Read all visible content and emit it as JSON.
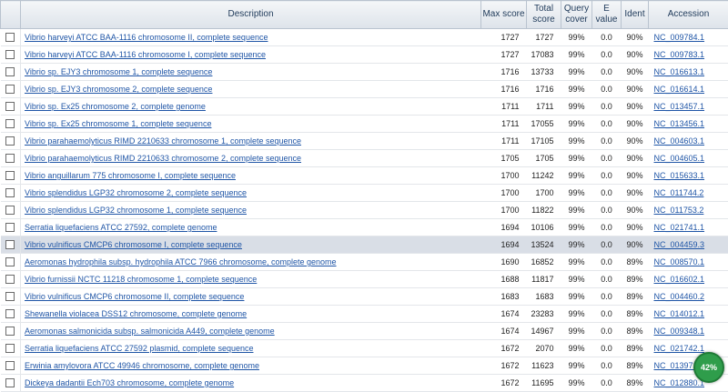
{
  "headers": {
    "description": "Description",
    "max_score": "Max score",
    "total_score_1": "Total",
    "total_score_2": "score",
    "query_cover_1": "Query",
    "query_cover_2": "cover",
    "e_value_1": "E",
    "e_value_2": "value",
    "ident": "Ident",
    "accession": "Accession"
  },
  "rows": [
    {
      "desc": "Vibrio harveyi ATCC BAA-1116 chromosome II, complete sequence",
      "max": "1727",
      "total": "1727",
      "cover": "99%",
      "e": "0.0",
      "ident": "90%",
      "acc": "NC_009784.1"
    },
    {
      "desc": "Vibrio harveyi ATCC BAA-1116 chromosome I, complete sequence",
      "max": "1727",
      "total": "17083",
      "cover": "99%",
      "e": "0.0",
      "ident": "90%",
      "acc": "NC_009783.1"
    },
    {
      "desc": "Vibrio sp. EJY3 chromosome 1, complete sequence",
      "max": "1716",
      "total": "13733",
      "cover": "99%",
      "e": "0.0",
      "ident": "90%",
      "acc": "NC_016613.1"
    },
    {
      "desc": "Vibrio sp. EJY3 chromosome 2, complete sequence",
      "max": "1716",
      "total": "1716",
      "cover": "99%",
      "e": "0.0",
      "ident": "90%",
      "acc": "NC_016614.1"
    },
    {
      "desc": "Vibrio sp. Ex25 chromosome 2, complete genome",
      "max": "1711",
      "total": "1711",
      "cover": "99%",
      "e": "0.0",
      "ident": "90%",
      "acc": "NC_013457.1"
    },
    {
      "desc": "Vibrio sp. Ex25 chromosome 1, complete sequence",
      "max": "1711",
      "total": "17055",
      "cover": "99%",
      "e": "0.0",
      "ident": "90%",
      "acc": "NC_013456.1"
    },
    {
      "desc": "Vibrio parahaemolyticus RIMD 2210633 chromosome 1, complete sequence",
      "max": "1711",
      "total": "17105",
      "cover": "99%",
      "e": "0.0",
      "ident": "90%",
      "acc": "NC_004603.1"
    },
    {
      "desc": "Vibrio parahaemolyticus RIMD 2210633 chromosome 2, complete sequence",
      "max": "1705",
      "total": "1705",
      "cover": "99%",
      "e": "0.0",
      "ident": "90%",
      "acc": "NC_004605.1"
    },
    {
      "desc": "Vibrio anguillarum 775 chromosome I, complete sequence",
      "max": "1700",
      "total": "11242",
      "cover": "99%",
      "e": "0.0",
      "ident": "90%",
      "acc": "NC_015633.1"
    },
    {
      "desc": "Vibrio splendidus LGP32 chromosome 2, complete sequence",
      "max": "1700",
      "total": "1700",
      "cover": "99%",
      "e": "0.0",
      "ident": "90%",
      "acc": "NC_011744.2"
    },
    {
      "desc": "Vibrio splendidus LGP32 chromosome 1, complete sequence",
      "max": "1700",
      "total": "11822",
      "cover": "99%",
      "e": "0.0",
      "ident": "90%",
      "acc": "NC_011753.2"
    },
    {
      "desc": "Serratia liquefaciens ATCC 27592, complete genome",
      "max": "1694",
      "total": "10106",
      "cover": "99%",
      "e": "0.0",
      "ident": "90%",
      "acc": "NC_021741.1"
    },
    {
      "desc": "Vibrio vulnificus CMCP6 chromosome I, complete sequence",
      "max": "1694",
      "total": "13524",
      "cover": "99%",
      "e": "0.0",
      "ident": "90%",
      "acc": "NC_004459.3",
      "highlight": true
    },
    {
      "desc": "Aeromonas hydrophila subsp. hydrophila ATCC 7966 chromosome, complete genome",
      "max": "1690",
      "total": "16852",
      "cover": "99%",
      "e": "0.0",
      "ident": "89%",
      "acc": "NC_008570.1"
    },
    {
      "desc": "Vibrio furnissii NCTC 11218 chromosome 1, complete sequence",
      "max": "1688",
      "total": "11817",
      "cover": "99%",
      "e": "0.0",
      "ident": "89%",
      "acc": "NC_016602.1"
    },
    {
      "desc": "Vibrio vulnificus CMCP6 chromosome II, complete sequence",
      "max": "1683",
      "total": "1683",
      "cover": "99%",
      "e": "0.0",
      "ident": "89%",
      "acc": "NC_004460.2"
    },
    {
      "desc": "Shewanella violacea DSS12 chromosome, complete genome",
      "max": "1674",
      "total": "23283",
      "cover": "99%",
      "e": "0.0",
      "ident": "89%",
      "acc": "NC_014012.1"
    },
    {
      "desc": "Aeromonas salmonicida subsp. salmonicida A449, complete genome",
      "max": "1674",
      "total": "14967",
      "cover": "99%",
      "e": "0.0",
      "ident": "89%",
      "acc": "NC_009348.1"
    },
    {
      "desc": "Serratia liquefaciens ATCC 27592 plasmid, complete sequence",
      "max": "1672",
      "total": "2070",
      "cover": "99%",
      "e": "0.0",
      "ident": "89%",
      "acc": "NC_021742.1"
    },
    {
      "desc": "Erwinia amylovora ATCC 49946 chromosome, complete genome",
      "max": "1672",
      "total": "11623",
      "cover": "99%",
      "e": "0.0",
      "ident": "89%",
      "acc": "NC_013971.1"
    },
    {
      "desc": "Dickeya dadantii Ech703 chromosome, complete genome",
      "max": "1672",
      "total": "11695",
      "cover": "99%",
      "e": "0.0",
      "ident": "89%",
      "acc": "NC_012880.1"
    }
  ],
  "progress_badge": {
    "label": "42%",
    "value": 0.42,
    "color": "#2f9d4b"
  }
}
